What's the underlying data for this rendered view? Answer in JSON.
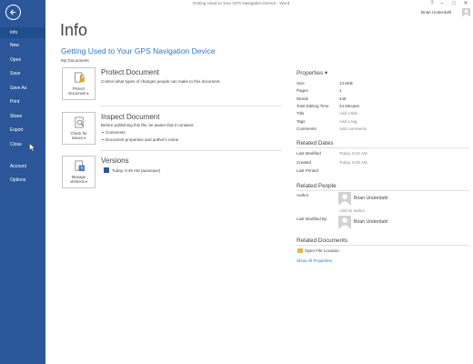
{
  "titlebar": {
    "title": "Getting Used to Your GPS Navigation Device - Word",
    "help": "?",
    "minimize": "–",
    "maximize": "□",
    "close": "✕",
    "user_name": "Brian Underdahl"
  },
  "nav": {
    "back_icon": "back-arrow-icon",
    "items": [
      {
        "label": "Info"
      },
      {
        "label": "New"
      },
      {
        "label": "Open"
      },
      {
        "label": "Save"
      },
      {
        "label": "Save As"
      },
      {
        "label": "Print"
      },
      {
        "label": "Share"
      },
      {
        "label": "Export"
      },
      {
        "label": "Close"
      },
      {
        "label": "Account"
      },
      {
        "label": "Options"
      }
    ],
    "active": "Info",
    "colors": {
      "background": "#2b579a",
      "active": "#1f4e8c"
    }
  },
  "main": {
    "page_title": "Info",
    "doc_title": "Getting Used to Your GPS Navigation Device",
    "doc_location": "My Documents",
    "sections": [
      {
        "button_label_1": "Protect",
        "button_label_2": "Document ▾",
        "icon": "lock-icon",
        "heading": "Protect Document",
        "description": "Control what types of changes people can make to this document."
      },
      {
        "button_label_1": "Check for",
        "button_label_2": "Issues ▾",
        "icon": "inspect-document-icon",
        "heading": "Inspect Document",
        "description": "Before publishing this file, be aware that it contains:",
        "bullets": [
          "Comments",
          "Document properties and author's name"
        ]
      },
      {
        "button_label_1": "Manage",
        "button_label_2": "Versions ▾",
        "icon": "versions-icon",
        "heading": "Versions",
        "version_entry": "Today, 9:49 AM (autosave)"
      }
    ]
  },
  "properties": {
    "heading": "Properties ▾",
    "rows": [
      {
        "label": "Size",
        "value": "13.6KB"
      },
      {
        "label": "Pages",
        "value": "1"
      },
      {
        "label": "Words",
        "value": "446"
      },
      {
        "label": "Total Editing Time",
        "value": "24 Minutes"
      },
      {
        "label": "Title",
        "value": "Add a title"
      },
      {
        "label": "Tags",
        "value": "Add a tag"
      },
      {
        "label": "Comments",
        "value": "Add comments"
      }
    ]
  },
  "related_dates": {
    "heading": "Related Dates",
    "rows": [
      {
        "label": "Last Modified",
        "value": "Today, 9:32 AM"
      },
      {
        "label": "Created",
        "value": "Today, 9:26 AM"
      },
      {
        "label": "Last Printed",
        "value": ""
      }
    ]
  },
  "related_people": {
    "heading": "Related People",
    "author_label": "Author",
    "author_name": "Brian Underdahl",
    "add_author": "Add an author",
    "modified_by_label": "Last Modified By",
    "modified_by_name": "Brian Underdahl"
  },
  "related_documents": {
    "heading": "Related Documents",
    "open_location": "Open File Location",
    "show_all": "Show All Properties"
  }
}
